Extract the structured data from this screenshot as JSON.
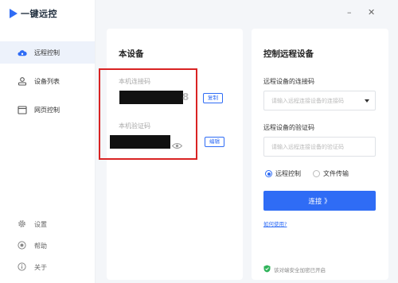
{
  "app": {
    "name": "一键远控",
    "brand_color": "#2f6cf5"
  },
  "sidebar": {
    "items": [
      {
        "label": "远程控制",
        "icon": "cloud-icon",
        "active": true
      },
      {
        "label": "设备列表",
        "icon": "device-list-icon",
        "active": false
      },
      {
        "label": "网页控制",
        "icon": "web-icon",
        "active": false
      }
    ],
    "bottom": [
      {
        "label": "设置",
        "icon": "gear-icon"
      },
      {
        "label": "帮助",
        "icon": "help-icon"
      },
      {
        "label": "关于",
        "icon": "info-icon"
      }
    ]
  },
  "window": {
    "minimize": "–",
    "close": "✕"
  },
  "local_device": {
    "title": "本设备",
    "conn_code_label": "本机连接码",
    "conn_code_visible_tail": "8",
    "copy_button": "复制",
    "verify_code_label": "本机验证码",
    "edit_button": "编辑"
  },
  "remote": {
    "title": "控制远程设备",
    "conn_code_label": "远程设备的连接码",
    "conn_code_placeholder": "请输入远程连接设备的连接码",
    "verify_code_label": "远程设备的验证码",
    "verify_code_placeholder": "请输入远程连接设备的验证码",
    "modes": [
      {
        "label": "远程控制",
        "checked": true
      },
      {
        "label": "文件传输",
        "checked": false
      }
    ],
    "connect_button": "连接 》",
    "help_link": "如何使用?",
    "security_text": "该对端安全加密已开启"
  }
}
